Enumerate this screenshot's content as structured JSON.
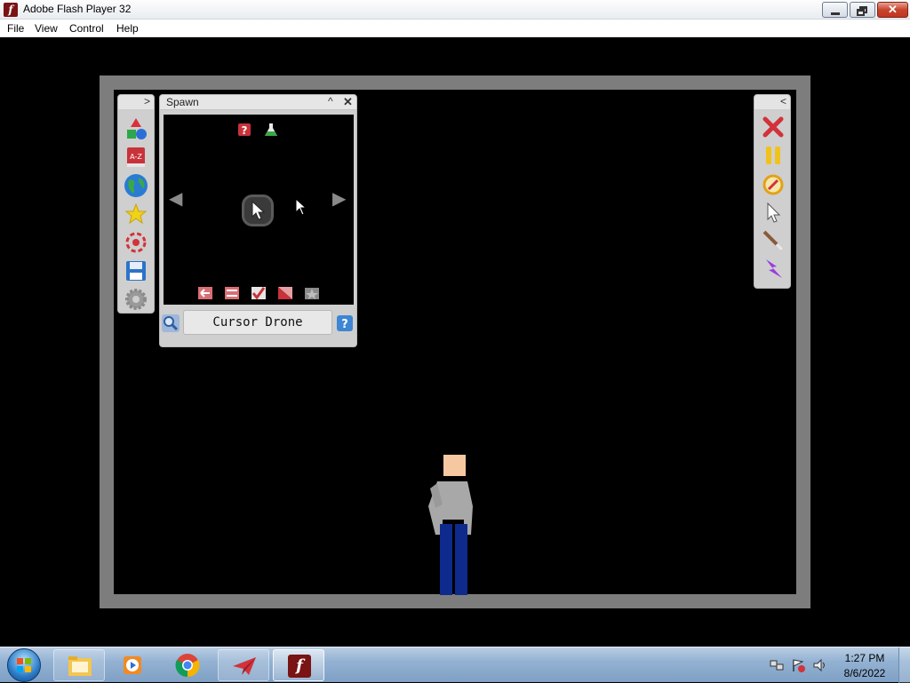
{
  "window": {
    "title": "Adobe Flash Player 32",
    "app_icon_glyph": "f"
  },
  "menu": [
    "File",
    "View",
    "Control",
    "Help"
  ],
  "left_toolbar": {
    "collapse_glyph": ">",
    "icons": [
      "shapes-icon",
      "a-z-icon",
      "globe-icon",
      "star-icon",
      "target-icon",
      "save-icon",
      "gear-icon"
    ]
  },
  "spawn_panel": {
    "title": "Spawn",
    "collapse_glyph": "^",
    "close_glyph": "✕",
    "prev_glyph": "◀",
    "next_glyph": "▶",
    "selected_name": "Cursor Drone"
  },
  "right_toolbar": {
    "collapse_glyph": "<",
    "icons": [
      "close-red-icon",
      "pause-icon",
      "compass-icon",
      "pointer-icon",
      "wand-icon",
      "lightning-icon"
    ]
  },
  "taskbar": {
    "time": "1:27 PM",
    "date": "8/6/2022"
  },
  "colors": {
    "stage_frame": "#7d7d7d",
    "panel_bg": "#cfcfcf",
    "ragdoll_shirt": "#a8a8a8",
    "ragdoll_pants": "#0e2a8c",
    "ragdoll_skin": "#f6c8a2"
  }
}
